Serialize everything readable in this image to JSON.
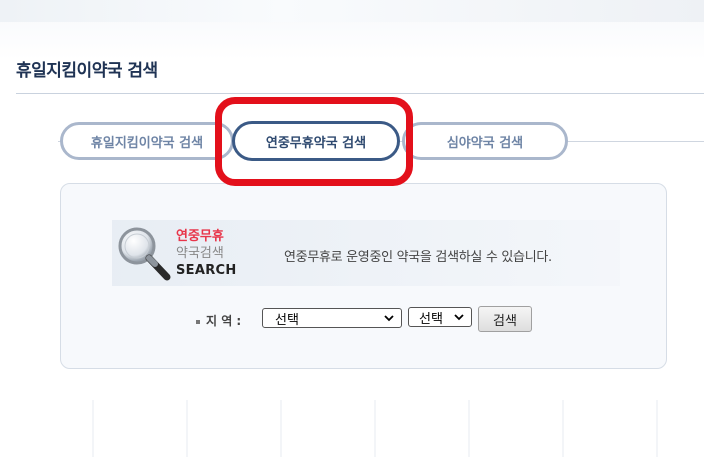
{
  "page": {
    "title": "휴일지킴이약국 검색"
  },
  "tabs": [
    {
      "label": "휴일지킴이약국 검색",
      "active": false
    },
    {
      "label": "연중무휴약국 검색",
      "active": true
    },
    {
      "label": "심야약국 검색",
      "active": false
    }
  ],
  "colors": {
    "title": "#1f3354",
    "active_tab_border": "#3b5a86",
    "inactive_tab_border": "#aab7cc",
    "highlight": "#e3101b",
    "badge_red": "#e8354a"
  },
  "panel": {
    "badge_line1": "연중무휴",
    "badge_line2": "약국검색",
    "badge_line3": "SEARCH",
    "icon": "magnifier-icon",
    "description": "연중무휴로 운영중인 약국을 검색하실 수 있습니다."
  },
  "form": {
    "region_label": "지 역 :",
    "region_select_value": "선택",
    "subregion_select_value": "선택",
    "search_button": "검색"
  }
}
